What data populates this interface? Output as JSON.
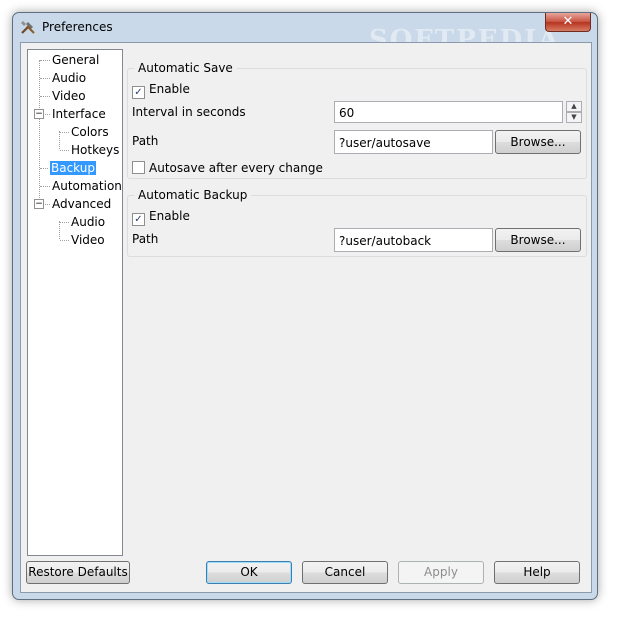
{
  "window": {
    "title": "Preferences",
    "close_symbol": "✕"
  },
  "tree": {
    "items": [
      {
        "label": "General"
      },
      {
        "label": "Audio"
      },
      {
        "label": "Video"
      },
      {
        "label": "Interface",
        "expanded": true
      },
      {
        "label": "Colors"
      },
      {
        "label": "Hotkeys"
      },
      {
        "label": "Backup",
        "selected": true
      },
      {
        "label": "Automation"
      },
      {
        "label": "Advanced",
        "expanded": true
      },
      {
        "label": "Audio"
      },
      {
        "label": "Video"
      }
    ]
  },
  "auto_save": {
    "title": "Automatic Save",
    "enable_label": "Enable",
    "enable_checked": true,
    "interval_label": "Interval in seconds",
    "interval_value": "60",
    "path_label": "Path",
    "path_value": "?user/autosave",
    "browse_label": "Browse...",
    "autosave_change_label": "Autosave after every change",
    "autosave_change_checked": false
  },
  "auto_backup": {
    "title": "Automatic Backup",
    "enable_label": "Enable",
    "enable_checked": true,
    "path_label": "Path",
    "path_value": "?user/autoback",
    "browse_label": "Browse..."
  },
  "buttons": {
    "restore": "Restore Defaults",
    "ok": "OK",
    "cancel": "Cancel",
    "apply": "Apply",
    "help": "Help"
  },
  "symbols": {
    "check": "✓",
    "collapse": "−",
    "spin_up": "▲",
    "spin_down": "▼"
  },
  "watermark": "SOFTPEDIA"
}
